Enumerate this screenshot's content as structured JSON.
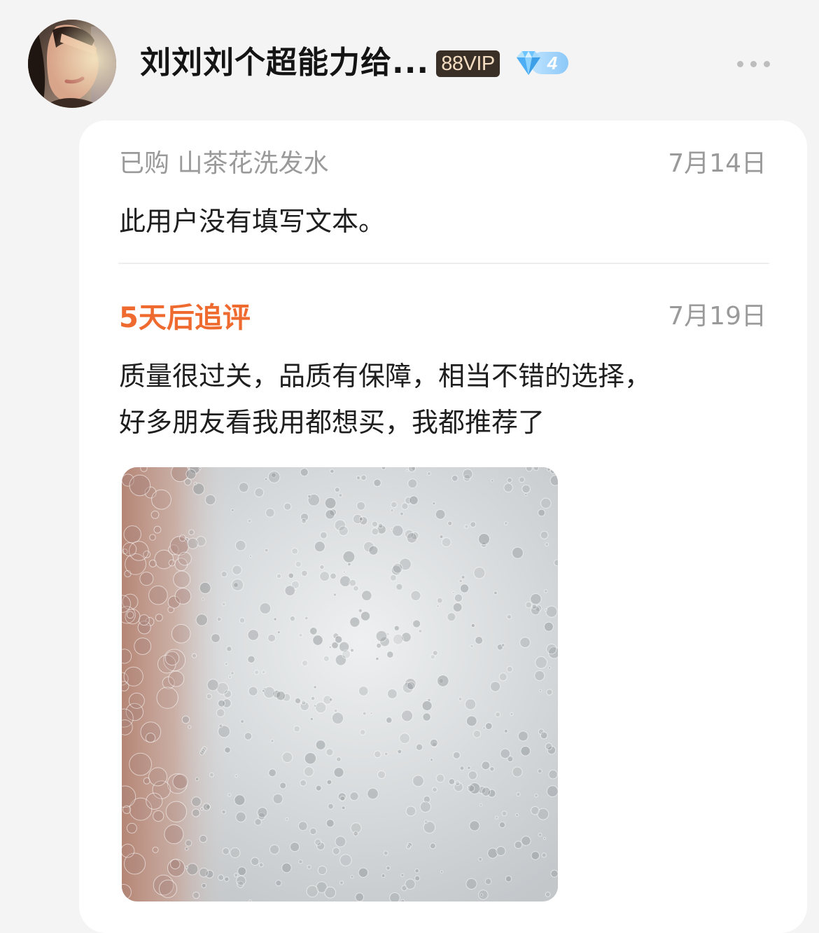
{
  "header": {
    "avatar_alt": "user avatar",
    "username": "刘刘刘个超能力给...",
    "vip_badge": "88VIP",
    "level": "4",
    "more_icon": "more-dots-icon"
  },
  "review": {
    "purchase_label": "已购 山茶花洗发水",
    "date": "7月14日",
    "text": "此用户没有填写文本。"
  },
  "followup": {
    "label": "5天后追评",
    "date": "7月19日",
    "lines": [
      "质量很过关，品质有保障，相当不错的选择，",
      "好多朋友看我用都想买，我都推荐了"
    ],
    "photo_alt": "shampoo foam photo"
  },
  "colors": {
    "accent_orange": "#ef6a2f",
    "muted_text": "#9a9a9a",
    "vip_bg": "#3a2f27",
    "vip_text": "#f3dcc0",
    "level_blue": "#8cc8f8"
  }
}
